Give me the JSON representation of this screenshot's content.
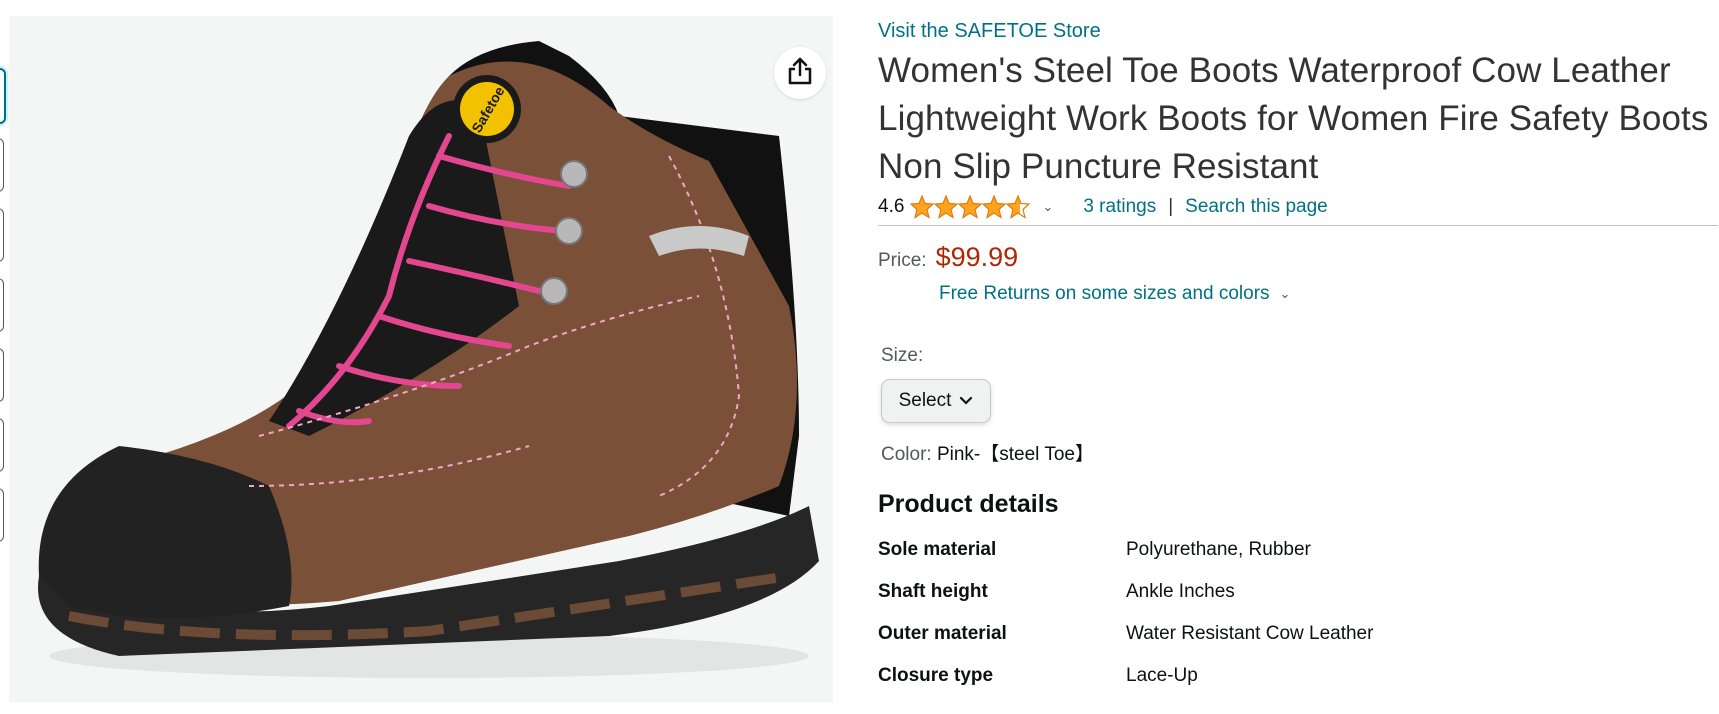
{
  "store_link": "Visit the SAFETOE Store",
  "title": "Women's Steel Toe Boots Waterproof Cow Leather Lightweight Work Boots for Women Fire Safety Boots Non Slip Puncture Resistant",
  "rating": {
    "value": "4.6",
    "stars": 4.6,
    "count_label": "3 ratings",
    "search_label": "Search this page",
    "separator": "|"
  },
  "price": {
    "label": "Price:",
    "amount": "$99.99",
    "returns": "Free Returns on some sizes and colors"
  },
  "size": {
    "label": "Size:",
    "select_value": "Select"
  },
  "color": {
    "label": "Color:",
    "value": "Pink-【steel Toe】"
  },
  "details": {
    "title": "Product details",
    "rows": [
      {
        "key": "Sole material",
        "value": "Polyurethane, Rubber"
      },
      {
        "key": "Shaft height",
        "value": "Ankle Inches"
      },
      {
        "key": "Outer material",
        "value": "Water Resistant Cow Leather"
      },
      {
        "key": "Closure type",
        "value": "Lace-Up"
      }
    ]
  },
  "image": {
    "logo_text": "Safetoe",
    "icon": "share-icon"
  },
  "colors": {
    "link": "#007185",
    "price": "#B12704",
    "star": "#FFA41C",
    "boot_leather": "#7a5038",
    "lace_pink": "#e2478f"
  }
}
